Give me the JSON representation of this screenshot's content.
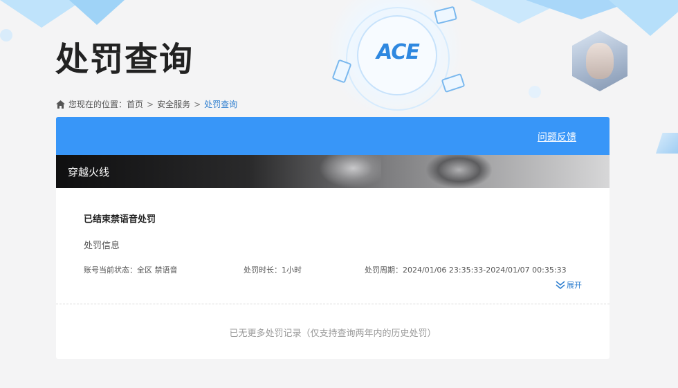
{
  "page": {
    "title": "处罚查询"
  },
  "breadcrumb": {
    "prefix": "您现在的位置：",
    "items": [
      "首页",
      "安全服务"
    ],
    "current": "处罚查询",
    "separator": ">"
  },
  "panel": {
    "feedback_label": "问题反馈",
    "game_name": "穿越火线",
    "record": {
      "title": "已结束禁语音处罚",
      "info_label": "处罚信息",
      "status": "账号当前状态：全区 禁语音",
      "duration": "处罚时长：1小时",
      "period": "处罚周期：2024/01/06 23:35:33-2024/01/07 00:35:33",
      "expand_label": "展开"
    },
    "footer_note": "已无更多处罚记录（仅支持查询两年内的历史处罚）"
  },
  "branding": {
    "logo_text": "ACE"
  },
  "colors": {
    "accent": "#3896f8",
    "link": "#2f7fd0",
    "title": "#222222",
    "muted": "#999999"
  },
  "icons": {
    "home": "home-icon",
    "expand": "double-chevron-down-icon"
  }
}
